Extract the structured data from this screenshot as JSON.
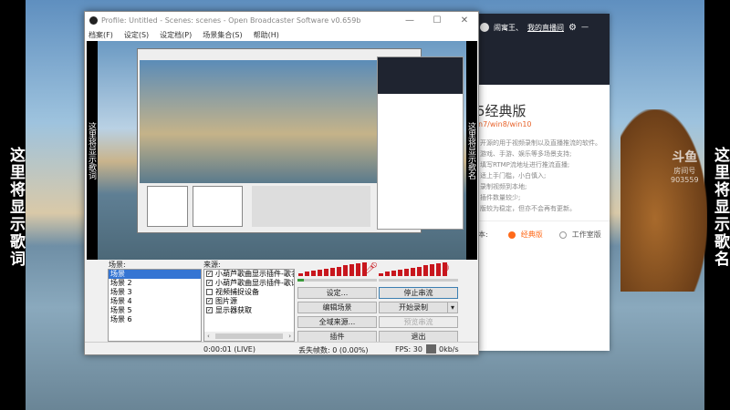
{
  "overlay": {
    "left_strip": "这里将显示歌词",
    "right_strip": "这里将显示歌名"
  },
  "obs": {
    "title": "Profile: Untitled - Scenes: scenes - Open Broadcaster Software v0.659b",
    "menu": [
      "档案(F)",
      "设定(S)",
      "设定档(P)",
      "场景集合(S)",
      "帮助(H)"
    ],
    "scenes_label": "场景:",
    "scenes": [
      "场景",
      "场景 2",
      "场景 3",
      "场景 4",
      "场景 5",
      "场景 6"
    ],
    "sources_label": "来源:",
    "sources": [
      {
        "label": "小葫芦歌曲显示插件-歌名",
        "checked": true
      },
      {
        "label": "小葫芦歌曲显示插件-歌词",
        "checked": true
      },
      {
        "label": "视频捕捉设备",
        "checked": false
      },
      {
        "label": "图片源",
        "checked": true
      },
      {
        "label": "显示器获取",
        "checked": true
      }
    ],
    "buttons": {
      "settings": "设定...",
      "stop_stream": "停止串流",
      "edit_scene": "编辑场景",
      "start_record": "开始录制",
      "global_sources": "全域来源...",
      "preview_stream": "预览串流",
      "plugins": "插件",
      "exit": "退出"
    },
    "status": {
      "time": "0:00:01 (LIVE)",
      "dropped": "丢失帧数: 0 (0.00%)",
      "fps": "FPS: 30",
      "bitrate": "0kb/s"
    },
    "mic_level": 0.08
  },
  "douyu": {
    "username": "闹寓王、",
    "my_room": "我的直播间",
    "heading": "5经典版",
    "os": "n7/win8/win10",
    "desc": [
      "开源的用于视频录制以及直播推流的软件。",
      "游戏、手游、娱乐等多场景支持;",
      "填写RTMP流地址进行推流直播;",
      "适上手门槛，小白慎入;",
      "录制视频到本地;",
      "插件数量较少;",
      "版较为稳定，但亦不会再有更新。"
    ],
    "version_label": "本:",
    "option_classic": "经典版",
    "option_studio": "工作室版"
  },
  "watermark": {
    "brand": "斗鱼",
    "sub": "房间号",
    "num": "903559"
  }
}
